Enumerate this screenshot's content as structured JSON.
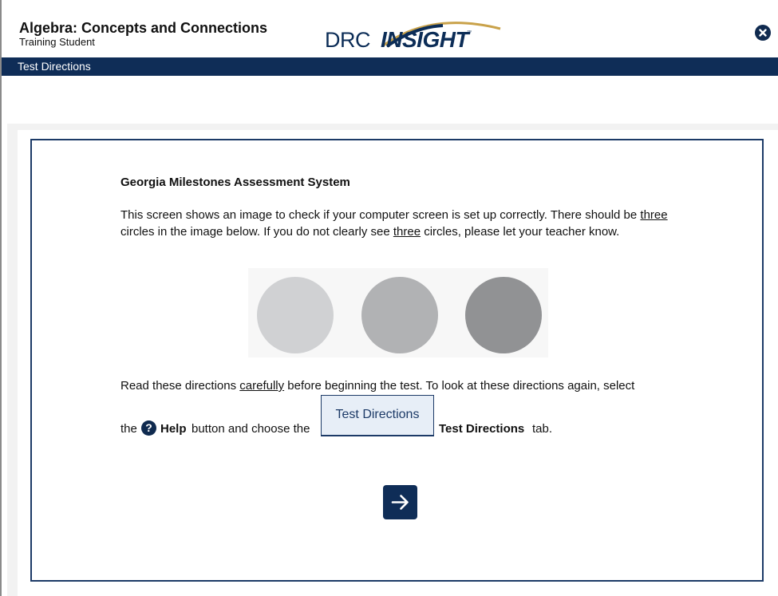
{
  "header": {
    "app_title": "Algebra: Concepts and Connections",
    "student_name": "Training Student",
    "logo_drc": "DRC",
    "logo_insight": "INSIGHT",
    "logo_tm": "™",
    "close_icon": "close-circle-icon"
  },
  "nav": {
    "active_tab": "Test Directions"
  },
  "content": {
    "heading": "Georgia Milestones Assessment System",
    "para1_a": "This screen shows an image to check if your computer screen is set up correctly. There should be ",
    "para1_u1": "three",
    "para1_b": " circles in the image below. If you do not clearly see ",
    "para1_u2": "three",
    "para1_c": " circles, please let your teacher know.",
    "circles": {
      "colors": [
        "#d0d1d3",
        "#b1b2b4",
        "#919294"
      ]
    },
    "para2_a": "Read these directions ",
    "para2_u": "carefully",
    "para2_b": " before beginning the test. To look at these directions again, select",
    "line3_the": "the",
    "help_icon_glyph": "?",
    "help_label": "Help",
    "line3_mid": "button and choose the",
    "tab_sample_label": "Test Directions",
    "td_label": "Test Directions",
    "tab_word": "tab.",
    "next_icon": "arrow-right-icon"
  },
  "colors": {
    "navy": "#0f2d57",
    "card_border": "#1c3a67"
  }
}
